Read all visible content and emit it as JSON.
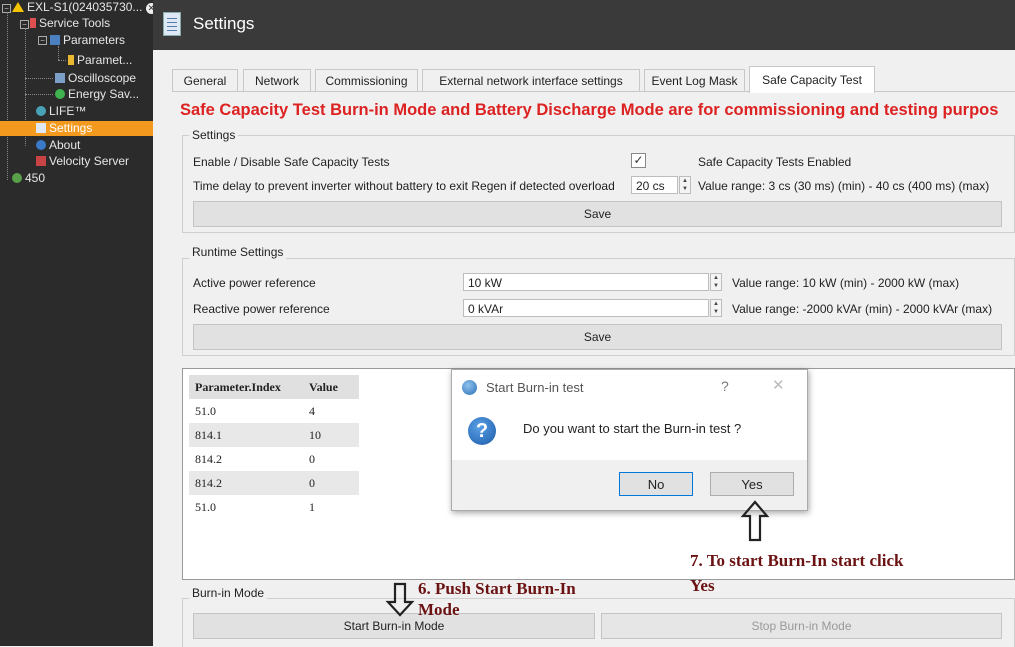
{
  "tree": {
    "root": "EXL-S1(024035730...",
    "items": [
      "Service Tools",
      "Parameters",
      "Paramet...",
      "Oscilloscope",
      "Energy Sav...",
      "LIFE™",
      "Settings",
      "About",
      "Velocity Server",
      "450"
    ]
  },
  "header": {
    "title": "Settings"
  },
  "tabs": [
    "General",
    "Network",
    "Commissioning",
    "External network interface settings",
    "Event Log Mask",
    "Safe Capacity Test"
  ],
  "warning": "Safe Capacity Test Burn-in Mode and Battery Discharge Mode are for commissioning and testing purpos",
  "settings": {
    "group_label": "Settings",
    "enable_label": "Enable / Disable Safe Capacity Tests",
    "enabled_text": "Safe Capacity Tests Enabled",
    "time_label": "Time delay to prevent inverter without battery to exit Regen if detected overload",
    "time_value": "20 cs",
    "time_range": "Value range: 3 cs (30 ms) (min) - 40 cs (400 ms) (max)",
    "save": "Save"
  },
  "runtime": {
    "group_label": "Runtime Settings",
    "active_label": "Active power reference",
    "active_value": "10 kW",
    "active_range": "Value range: 10 kW (min) - 2000 kW (max)",
    "reactive_label": "Reactive power reference",
    "reactive_value": "0 kVAr",
    "reactive_range": "Value range: -2000 kVAr (min) - 2000 kVAr (max)",
    "save": "Save"
  },
  "table": {
    "headers": [
      "Parameter.Index",
      "Value"
    ],
    "rows": [
      [
        "51.0",
        "4"
      ],
      [
        "814.1",
        "10"
      ],
      [
        "814.2",
        "0"
      ],
      [
        "814.2",
        "0"
      ],
      [
        "51.0",
        "1"
      ]
    ]
  },
  "dialog": {
    "title": "Start Burn-in test",
    "help": "?",
    "close": "✕",
    "message": "Do you want to start the Burn-in test ?",
    "no": "No",
    "yes": "Yes"
  },
  "annotations": {
    "step7_line1": "7. To start Burn-In start click",
    "step7_line2": "Yes",
    "step6_line1": "6. Push Start Burn-In",
    "step6_line2": "Mode"
  },
  "burnin": {
    "group_label": "Burn-in Mode",
    "start": "Start Burn-in Mode",
    "stop": "Stop Burn-in Mode"
  },
  "colors": {
    "accent": "#f39a1e",
    "warning": "#dd2222",
    "annotation": "#6b1212"
  }
}
